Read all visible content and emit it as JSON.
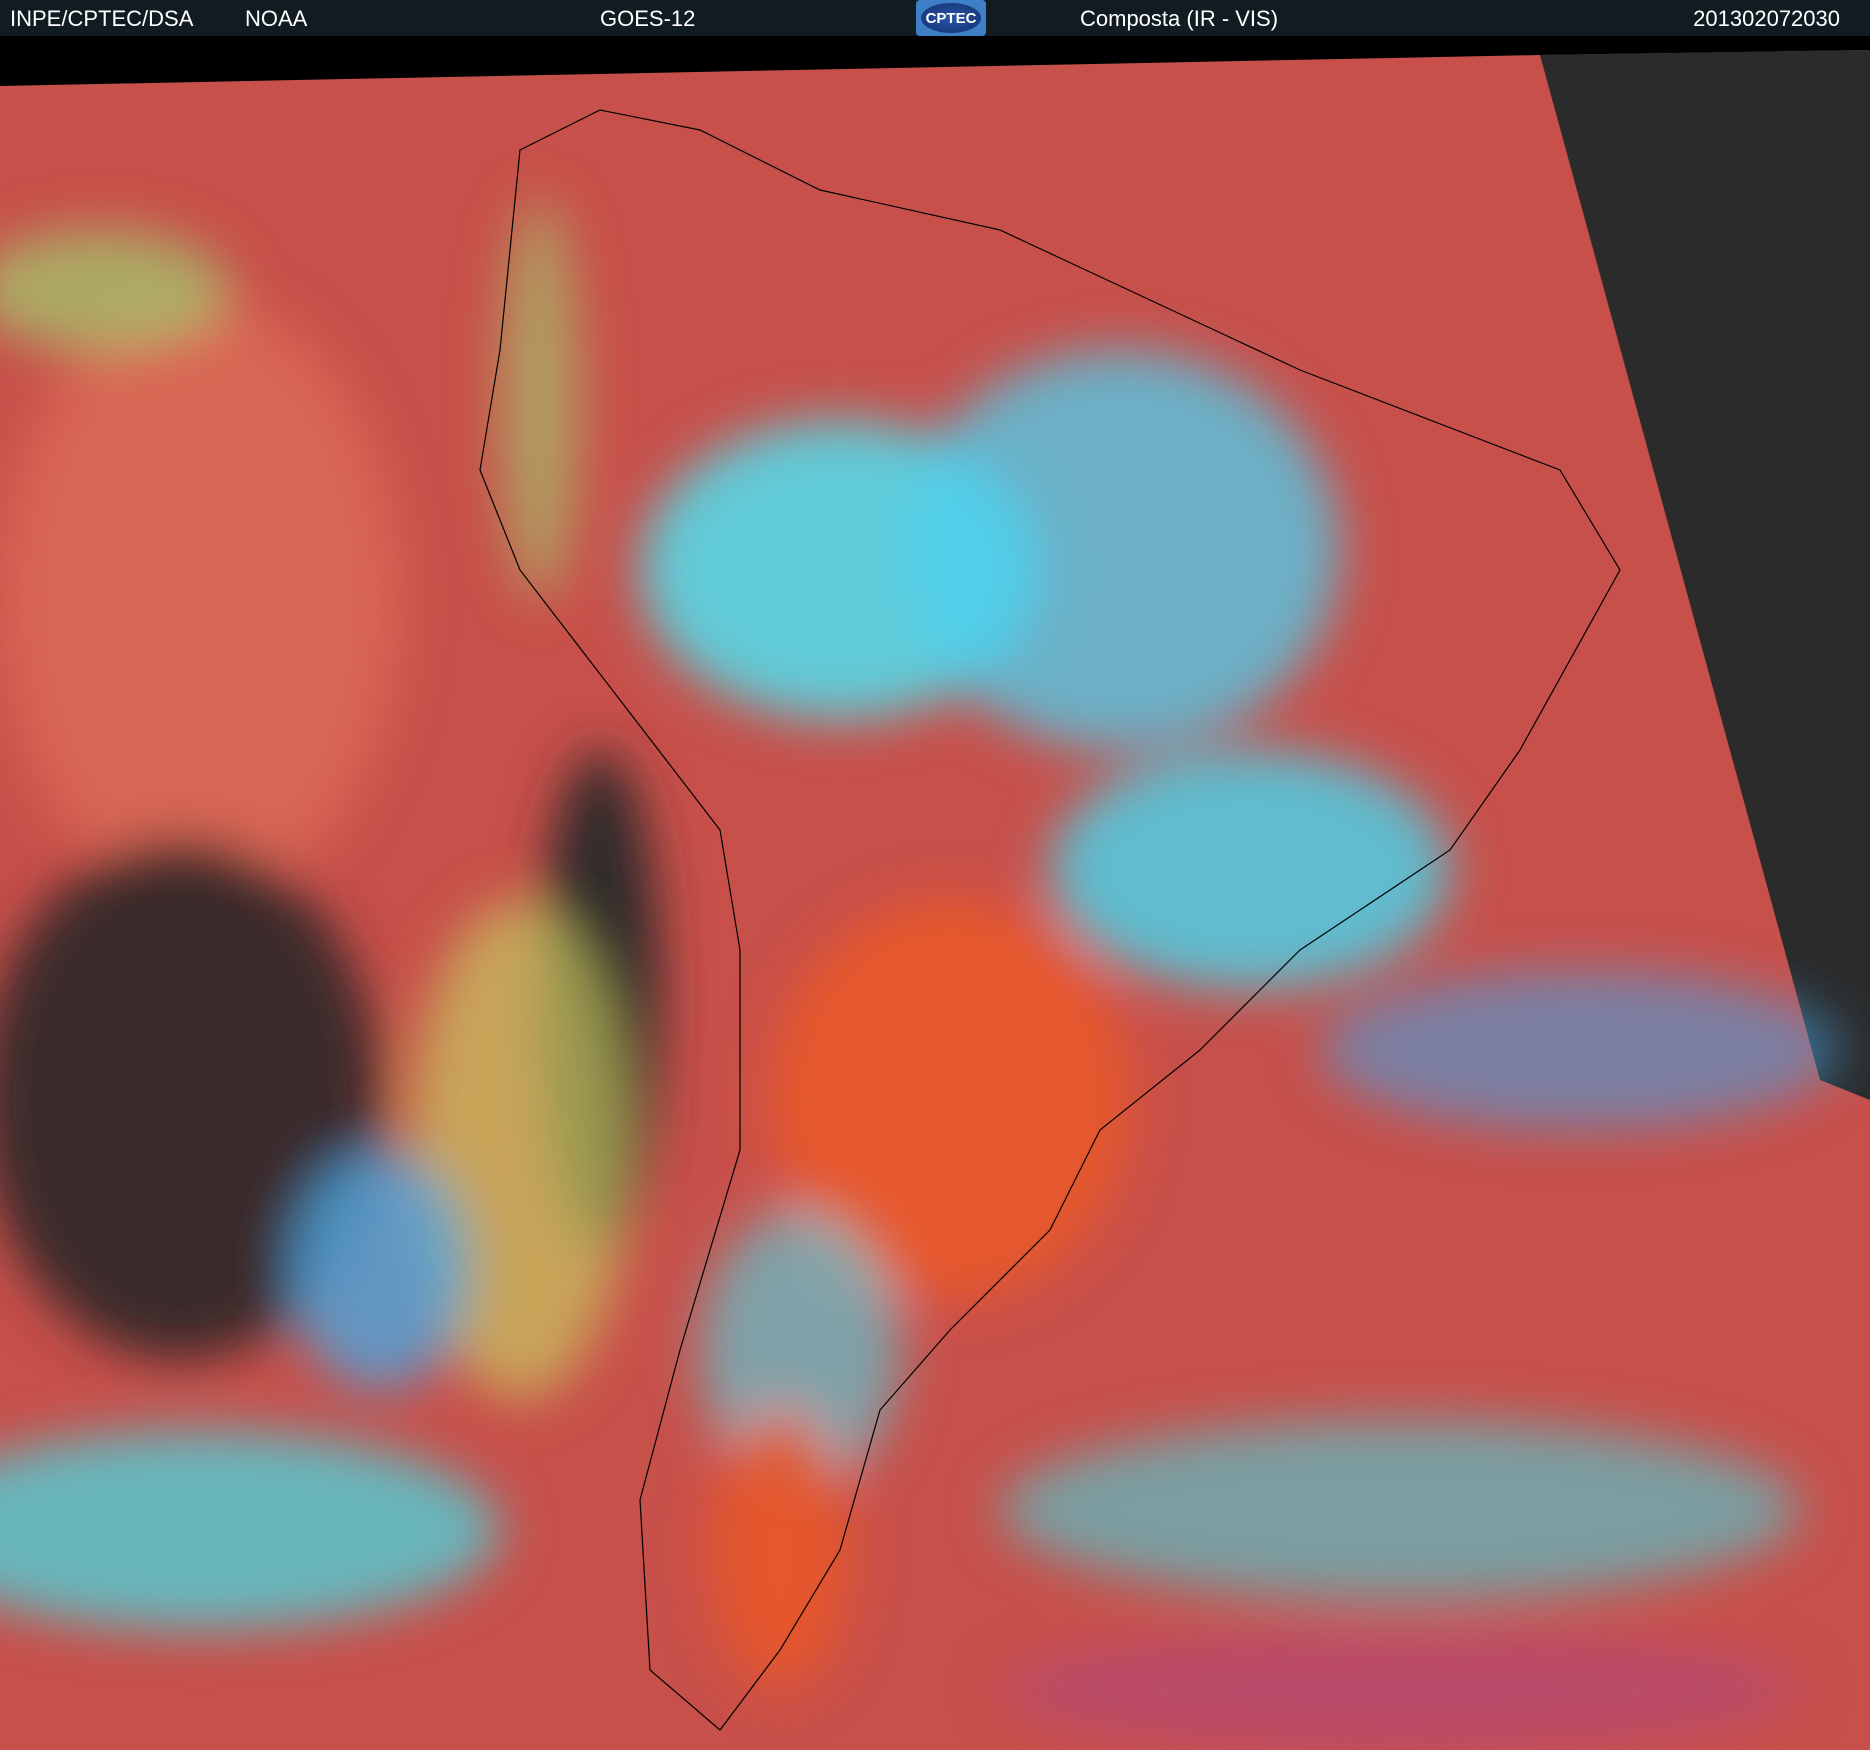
{
  "header": {
    "institution": "INPE/CPTEC/DSA",
    "agency": "NOAA",
    "satellite": "GOES-12",
    "logo_text": "CPTEC",
    "product": "Composta (IR - VIS)",
    "timestamp": "201302072030"
  },
  "colors": {
    "header_bg": "#111c22",
    "ocean_red": "#c8504a",
    "cloud_cyan": "#3fe0f0",
    "land_orange": "#e8562a",
    "night_gray": "#2a2a2a"
  }
}
